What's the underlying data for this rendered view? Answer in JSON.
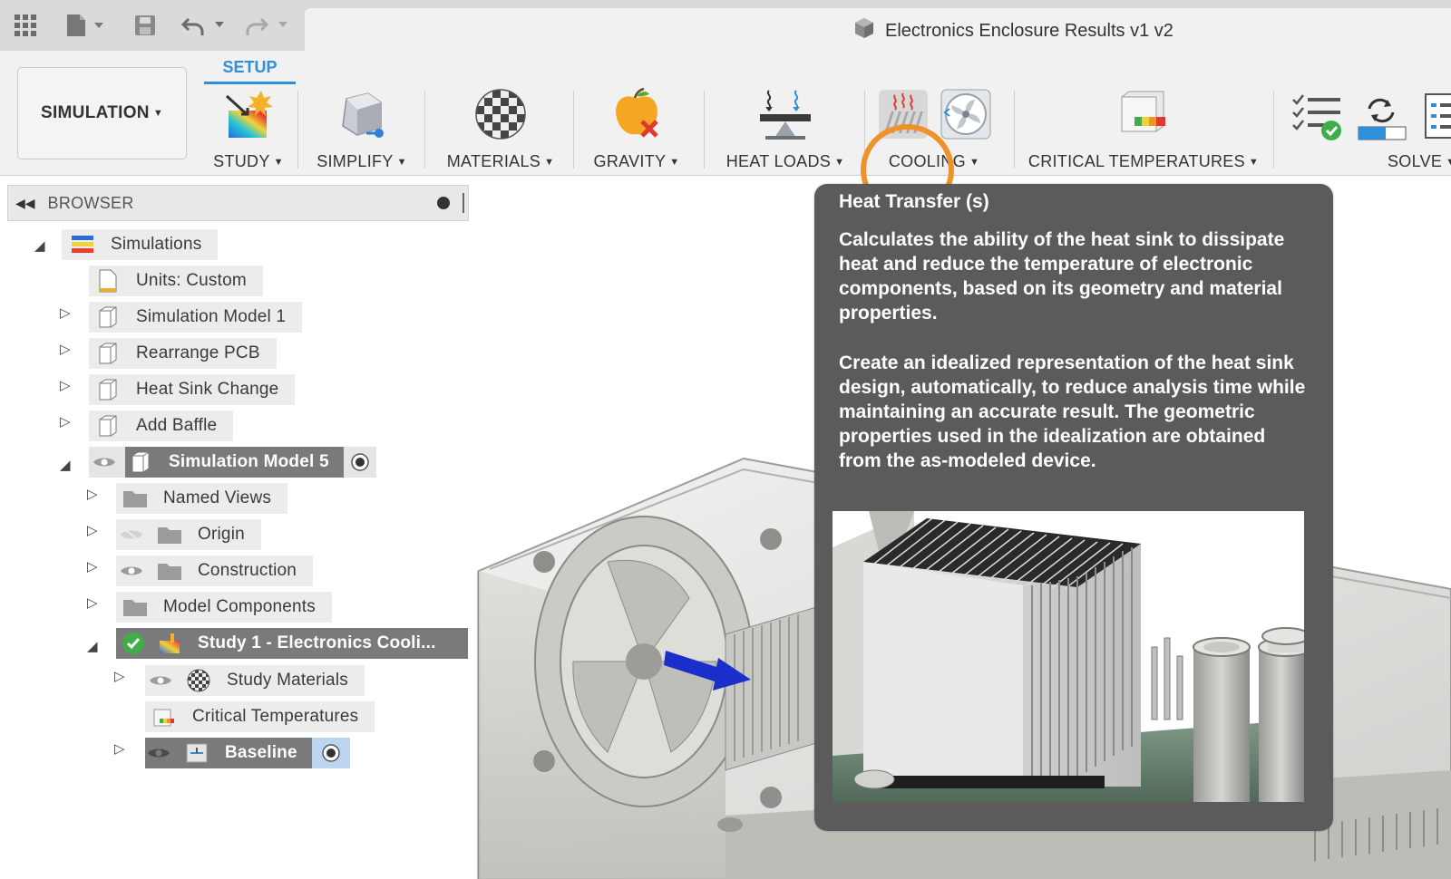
{
  "window": {
    "document_title": "Electronics Enclosure Results v1 v2"
  },
  "quick_access": {
    "icons": [
      "apps-grid-icon",
      "file-icon",
      "save-icon",
      "undo-icon",
      "redo-icon"
    ]
  },
  "ribbon": {
    "workspace_label": "SIMULATION",
    "active_tab": "SETUP",
    "tools": [
      {
        "label": "STUDY",
        "icon": "study-icon"
      },
      {
        "label": "SIMPLIFY",
        "icon": "simplify-icon"
      },
      {
        "label": "MATERIALS",
        "icon": "materials-icon"
      },
      {
        "label": "GRAVITY",
        "icon": "gravity-icon"
      },
      {
        "label": "HEAT LOADS",
        "icon": "heat-loads-icon"
      },
      {
        "label": "COOLING",
        "icon": "cooling-icon"
      },
      {
        "label": "CRITICAL TEMPERATURES",
        "icon": "critical-temperatures-icon"
      },
      {
        "label": "SOLVE",
        "icon": "solve-icon"
      }
    ],
    "highlight_color": "#f0922a",
    "accent_color": "#2f8fd8"
  },
  "browser": {
    "title": "BROWSER",
    "tree": {
      "root": "Simulations",
      "units": "Units: Custom",
      "sim_model_1": "Simulation Model 1",
      "rearrange": "Rearrange PCB",
      "heat_sink_change": "Heat Sink Change",
      "add_baffle": "Add Baffle",
      "sim_model_5": "Simulation Model 5",
      "named_views": "Named Views",
      "origin": "Origin",
      "construction": "Construction",
      "model_components": "Model Components",
      "study_1": "Study 1 - Electronics Cooli...",
      "study_materials": "Study Materials",
      "critical_temps": "Critical Temperatures",
      "baseline": "Baseline"
    }
  },
  "tooltip": {
    "title": "Heat Transfer (s)",
    "para1": "Calculates the ability of the heat sink to dissipate heat and reduce the temperature of electronic components, based on its geometry and material properties.",
    "para2": "Create an idealized representation of the heat sink design, automatically, to reduce analysis time while maintaining an accurate result. The geometric properties used in the idealization are obtained from the as-modeled device."
  }
}
